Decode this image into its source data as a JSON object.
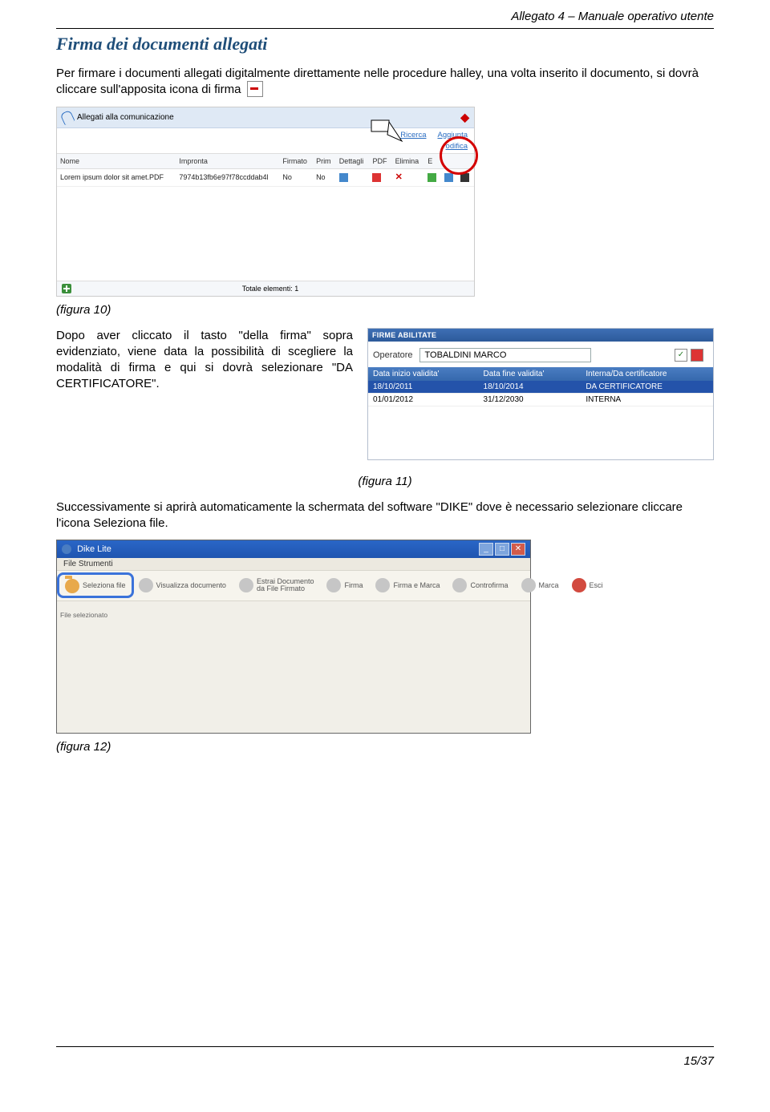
{
  "header_right": "Allegato 4 – Manuale operativo utente",
  "section_title": "Firma dei documenti allegati",
  "para1_a": "Per firmare i documenti allegati digitalmente direttamente nelle procedure halley, una volta inserito il documento, si dovrà cliccare sull'apposita icona di firma",
  "caption10": "(figura 10)",
  "para2": "Dopo aver cliccato il tasto \"della firma\" sopra evidenziato, viene data la possibilità di scegliere la modalità di firma e qui si dovrà selezionare \"DA CERTIFICATORE\".",
  "caption11": "(figura 11)",
  "para3": "Successivamente si aprirà automaticamente la schermata del software \"DIKE\" dove è necessario selezionare cliccare l'icona Seleziona file.",
  "caption12": "(figura 12)",
  "page_num": "15/37",
  "shot1": {
    "title": "Allegati alla comunicazione",
    "link_ricerca": "Ricerca",
    "link_aggiunta": "Aggiunta",
    "link_modifica": "odifica",
    "headers": [
      "Nome",
      "Impronta",
      "Firmato",
      "Prim",
      "Dettagli",
      "PDF",
      "Elimina",
      "E"
    ],
    "row": {
      "nome": "Lorem ipsum dolor sit amet.PDF",
      "impronta": "7974b13fb6e97f78ccddab4l",
      "firmato": "No",
      "prim": "No"
    },
    "footer_label": "Totale elementi: 1"
  },
  "shot2": {
    "bar_title": "FIRME ABILITATE",
    "op_label": "Operatore",
    "op_value": "TOBALDINI MARCO",
    "headers": [
      "Data inizio validita'",
      "Data fine validita'",
      "Interna/Da certificatore"
    ],
    "rows": [
      {
        "start": "18/10/2011",
        "end": "18/10/2014",
        "type": "DA CERTIFICATORE",
        "selected": true
      },
      {
        "start": "01/01/2012",
        "end": "31/12/2030",
        "type": "INTERNA",
        "selected": false
      }
    ]
  },
  "shot3": {
    "title": "Dike Lite",
    "menu_file": "File   Strumenti",
    "btn_seleziona": "Seleziona file",
    "btn_visualizza": "Visualizza documento",
    "btn_estrai_l1": "Estrai Documento",
    "btn_estrai_l2": "da File Firmato",
    "btn_firma": "Firma",
    "btn_firma_marca": "Firma e Marca",
    "btn_controfirma": "Controfirma",
    "btn_marca": "Marca",
    "btn_esci": "Esci",
    "sidebar": "File selezionato"
  }
}
